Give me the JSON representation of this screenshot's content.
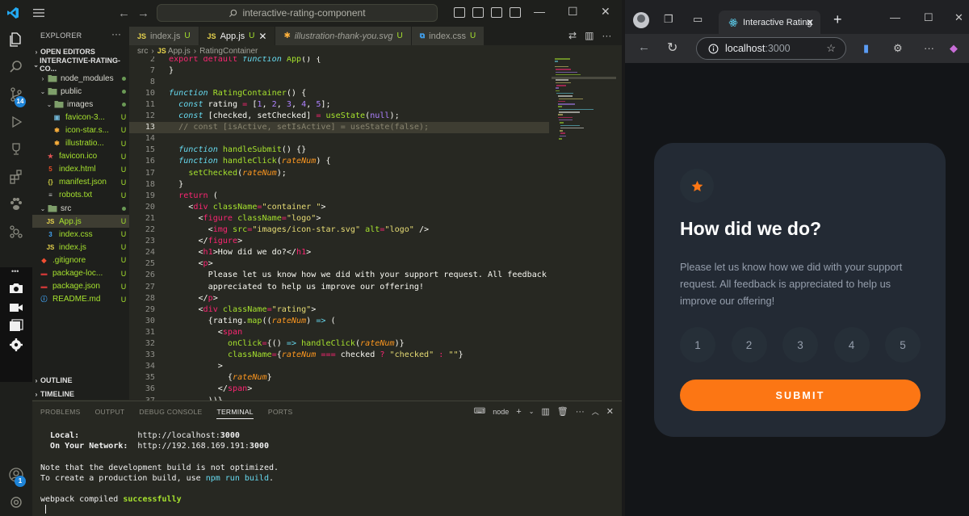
{
  "vscode": {
    "search_text": "interactive-rating-component",
    "explorer_title": "EXPLORER",
    "explorer_more": "···",
    "open_editors": "OPEN EDITORS",
    "project": "INTERACTIVE-RATING-CO...",
    "source_control_badge": "14",
    "accounts_badge": "1",
    "tree": [
      {
        "name": "node_modules",
        "kind": "folder",
        "open": false,
        "status": "dot"
      },
      {
        "name": "public",
        "kind": "folder",
        "open": true,
        "status": "dot"
      },
      {
        "name": "images",
        "kind": "folder",
        "open": true,
        "status": "dot"
      },
      {
        "name": "favicon-3...",
        "kind": "png",
        "status": "U"
      },
      {
        "name": "icon-star.s...",
        "kind": "svg",
        "status": "U"
      },
      {
        "name": "illustratio...",
        "kind": "svg",
        "status": "U"
      },
      {
        "name": "favicon.ico",
        "kind": "ico",
        "status": "U"
      },
      {
        "name": "index.html",
        "kind": "html",
        "status": "U"
      },
      {
        "name": "manifest.json",
        "kind": "json",
        "status": "U"
      },
      {
        "name": "robots.txt",
        "kind": "txt",
        "status": "U"
      },
      {
        "name": "src",
        "kind": "folder",
        "open": true,
        "status": "dot"
      },
      {
        "name": "App.js",
        "kind": "js",
        "status": "U",
        "selected": true
      },
      {
        "name": "index.css",
        "kind": "css",
        "status": "U"
      },
      {
        "name": "index.js",
        "kind": "js",
        "status": "U"
      },
      {
        "name": ".gitignore",
        "kind": "git",
        "status": "U"
      },
      {
        "name": "package-loc...",
        "kind": "npm",
        "status": "U"
      },
      {
        "name": "package.json",
        "kind": "npm",
        "status": "U"
      },
      {
        "name": "README.md",
        "kind": "md",
        "status": "U"
      }
    ],
    "outline": "OUTLINE",
    "timeline": "TIMELINE",
    "tabs": [
      {
        "label": "index.js",
        "badge": "JS",
        "status": "U",
        "active": false
      },
      {
        "label": "App.js",
        "badge": "JS",
        "status": "U",
        "active": true
      },
      {
        "label": "illustration-thank-you.svg",
        "badge": "svg",
        "status": "U",
        "active": false
      },
      {
        "label": "index.css",
        "badge": "css",
        "status": "U",
        "active": false
      }
    ],
    "breadcrumb": [
      "src",
      "JS App.js",
      "RatingContainer"
    ],
    "current_line": 13,
    "code_lines": [
      {
        "n": 2,
        "html": "<span class=\"kw\">export</span> <span class=\"kw\">default</span> <span class=\"k\">function</span> <span class=\"fn\">App</span>() {"
      },
      {
        "n": 7,
        "html": "}"
      },
      {
        "n": 8,
        "html": ""
      },
      {
        "n": 10,
        "html": "<span class=\"k\">function</span> <span class=\"fn\">RatingContainer</span>() {"
      },
      {
        "n": 11,
        "html": "  <span class=\"k\">const</span> rating <span class=\"kw\">=</span> [<span class=\"num\">1</span>, <span class=\"num\">2</span>, <span class=\"num\">3</span>, <span class=\"num\">4</span>, <span class=\"num\">5</span>];"
      },
      {
        "n": 12,
        "html": "  <span class=\"k\">const</span> [checked, setChecked] <span class=\"kw\">=</span> <span class=\"fn\">useState</span>(<span class=\"num\">null</span>);"
      },
      {
        "n": 13,
        "html": "  <span class=\"cm\">// const [isActive, setIsActive] = useState(false);</span>"
      },
      {
        "n": 14,
        "html": ""
      },
      {
        "n": 15,
        "html": "  <span class=\"k\">function</span> <span class=\"fn\">handleSubmit</span>() {}"
      },
      {
        "n": 16,
        "html": "  <span class=\"k\">function</span> <span class=\"fn\">handleClick</span>(<span class=\"pa\">rateNum</span>) {"
      },
      {
        "n": 17,
        "html": "    <span class=\"fn\">setChecked</span>(<span class=\"pa\">rateNum</span>);"
      },
      {
        "n": 18,
        "html": "  }"
      },
      {
        "n": 19,
        "html": "  <span class=\"kw\">return</span> ("
      },
      {
        "n": 20,
        "html": "    &lt;<span class=\"tg\">div</span> <span class=\"at\">className</span><span class=\"kw\">=</span><span class=\"str\">\"container \"</span>&gt;"
      },
      {
        "n": 21,
        "html": "      &lt;<span class=\"tg\">figure</span> <span class=\"at\">className</span><span class=\"kw\">=</span><span class=\"str\">\"logo\"</span>&gt;"
      },
      {
        "n": 22,
        "html": "        &lt;<span class=\"tg\">img</span> <span class=\"at\">src</span><span class=\"kw\">=</span><span class=\"str\">\"images/icon-star.svg\"</span> <span class=\"at\">alt</span><span class=\"kw\">=</span><span class=\"str\">\"logo\"</span> /&gt;"
      },
      {
        "n": 23,
        "html": "      &lt;/<span class=\"tg\">figure</span>&gt;"
      },
      {
        "n": 24,
        "html": "      &lt;<span class=\"tg\">h1</span>&gt;How did we do?&lt;/<span class=\"tg\">h1</span>&gt;"
      },
      {
        "n": 25,
        "html": "      &lt;<span class=\"tg\">p</span>&gt;"
      },
      {
        "n": 26,
        "html": "        Please let us know how we did with your support request. All feedback is"
      },
      {
        "n": 27,
        "html": "        appreciated to help us improve our offering!"
      },
      {
        "n": 28,
        "html": "      &lt;/<span class=\"tg\">p</span>&gt;"
      },
      {
        "n": 29,
        "html": "      &lt;<span class=\"tg\">div</span> <span class=\"at\">className</span><span class=\"kw\">=</span><span class=\"str\">\"rating\"</span>&gt;"
      },
      {
        "n": 30,
        "html": "        {rating.<span class=\"fn\">map</span>((<span class=\"pa\">rateNum</span>) <span class=\"k\">=&gt;</span> ("
      },
      {
        "n": 31,
        "html": "          &lt;<span class=\"tg\">span</span>"
      },
      {
        "n": 32,
        "html": "            <span class=\"at\">onClick</span><span class=\"kw\">=</span>{() <span class=\"k\">=&gt;</span> <span class=\"fn\">handleClick</span>(<span class=\"pa\">rateNum</span>)}"
      },
      {
        "n": 33,
        "html": "            <span class=\"at\">className</span><span class=\"kw\">=</span>{<span class=\"pa\">rateNum</span> <span class=\"kw\">===</span> checked <span class=\"kw\">?</span> <span class=\"str\">\"checked\"</span> <span class=\"kw\">:</span> <span class=\"str\">\"\"</span>}"
      },
      {
        "n": 34,
        "html": "          &gt;"
      },
      {
        "n": 35,
        "html": "            {<span class=\"pa\">rateNum</span>}"
      },
      {
        "n": 36,
        "html": "          &lt;/<span class=\"tg\">span</span>&gt;"
      },
      {
        "n": 37,
        "html": "        ))}"
      }
    ],
    "panel_tabs": [
      "PROBLEMS",
      "OUTPUT",
      "DEBUG CONSOLE",
      "TERMINAL",
      "PORTS"
    ],
    "panel_active": "TERMINAL",
    "terminal_label": "node",
    "terminal_lines": [
      {
        "html": "  <span class=\"b\">Local:</span>            http://localhost:<span class=\"b\">3000</span>"
      },
      {
        "html": "  <span class=\"b\">On Your Network:</span>  http://192.168.169.191:<span class=\"b\">3000</span>"
      },
      {
        "html": ""
      },
      {
        "html": "Note that the development build is not optimized."
      },
      {
        "html": "To create a production build, use <span class=\"blu\">npm run build</span>."
      },
      {
        "html": ""
      },
      {
        "html": "webpack compiled <span class=\"grn\">successfully</span>"
      }
    ]
  },
  "browser": {
    "tab_title": "Interactive Rating",
    "url_host": "localhost",
    "url_port": ":3000",
    "card": {
      "title": "How did we do?",
      "text": "Please let us know how we did with your support request. All feedback is appreciated to help us improve our offering!",
      "ratings": [
        "1",
        "2",
        "3",
        "4",
        "5"
      ],
      "submit": "SUBMIT"
    }
  },
  "colors": {
    "accent_orange": "#fc7614",
    "card_bg": "#232a34",
    "page_bg": "#131518"
  }
}
